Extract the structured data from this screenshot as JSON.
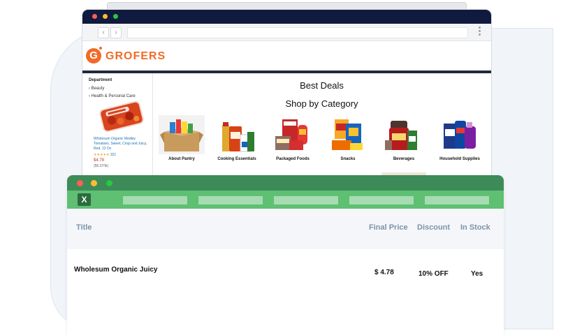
{
  "browser": {
    "nav_back": "‹",
    "nav_forward": "›"
  },
  "site": {
    "logo_letter": "G",
    "logo_text": "GROFERS",
    "logo_color": "#f26a28"
  },
  "sidebar": {
    "title": "Department",
    "items": [
      {
        "label": "Beauty"
      },
      {
        "label": "Health & Personal Care"
      }
    ]
  },
  "featured_product": {
    "name": "Wholesum Organic Medley Tomatoes, Sweet, Crisp and Juicy, Red, 12 Oz",
    "stars": "★★★★★",
    "rating_count": "321",
    "price": "$4.78",
    "unit_price": "($6.37/lb)"
  },
  "main": {
    "heading": "Best Deals",
    "subheading": "Shop by Category",
    "categories": [
      {
        "label": "About Pantry",
        "icon": "pantry-box-icon"
      },
      {
        "label": "Cooking Essentials",
        "icon": "cooking-essentials-icon"
      },
      {
        "label": "Packaged Foods",
        "icon": "packaged-foods-icon"
      },
      {
        "label": "Snacks",
        "icon": "snacks-icon"
      },
      {
        "label": "Beverages",
        "icon": "beverages-icon"
      },
      {
        "label": "Household Supplies",
        "icon": "household-supplies-icon"
      }
    ]
  },
  "excel": {
    "icon_label": "X",
    "accent_color": "#3d8b58",
    "columns": [
      "Title",
      "Final Price",
      "Discount",
      "In Stock"
    ],
    "rows": [
      {
        "title": "Wholesum Organic Juicy",
        "final_price": "$ 4.78",
        "discount": "10% OFF",
        "in_stock": "Yes"
      }
    ]
  }
}
